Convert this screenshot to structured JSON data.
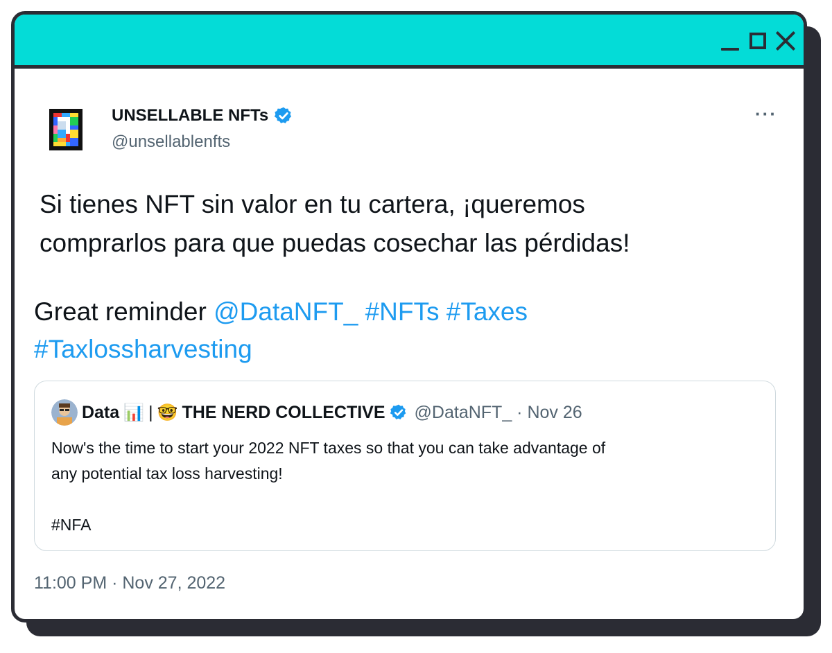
{
  "window": {
    "colors": {
      "titlebar": "#04dcd7",
      "frame": "#2b2c34",
      "link": "#1d9bf0"
    },
    "icons": [
      "minimize-icon",
      "maximize-icon",
      "close-icon"
    ]
  },
  "tweet": {
    "display_name": "UNSELLABLE NFTs",
    "handle": "@unsellablenfts",
    "more_label": "···",
    "body_line1": "Si tienes NFT sin valor en tu cartera, ¡queremos",
    "body_line2": "comprarlos para que puedas cosechar las pérdidas!",
    "body2_prefix": "Great reminder ",
    "mention": "@DataNFT_",
    "hashtag1": "#NFTs",
    "hashtag2": "#Taxes",
    "hashtag3": "#Taxlossharvesting",
    "timestamp": "11:00 PM · Nov 27, 2022"
  },
  "quote": {
    "name_part1": "Data",
    "emoji_chart": "📊",
    "separator": "|",
    "emoji_nerd": "🤓",
    "name_part2": "THE NERD COLLECTIVE",
    "handle_date": "@DataNFT_ · Nov 26",
    "text": "Now's the time to start your 2022 NFT taxes so that you can take advantage of\nany potential tax loss harvesting!\n\n#NFA"
  }
}
